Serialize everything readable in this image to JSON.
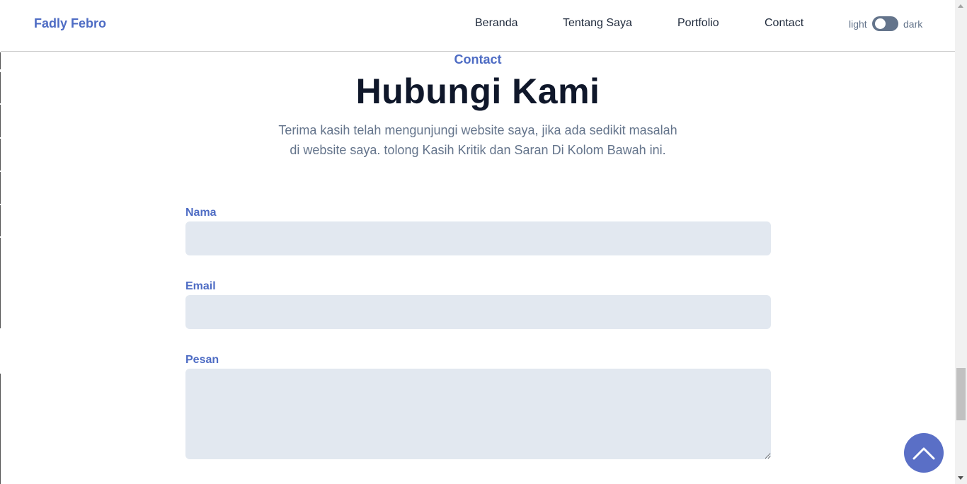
{
  "header": {
    "brand": "Fadly Febro",
    "nav": [
      "Beranda",
      "Tentang Saya",
      "Portfolio",
      "Contact"
    ],
    "theme_light": "light",
    "theme_dark": "dark"
  },
  "contact": {
    "tag": "Contact",
    "title": "Hubungi Kami",
    "description": "Terima kasih telah mengunjungi website saya, jika ada sedikit masalah di website saya. tolong Kasih Kritik dan Saran Di Kolom Bawah ini.",
    "fields": {
      "name_label": "Nama",
      "email_label": "Email",
      "message_label": "Pesan"
    }
  },
  "icons": {
    "toggle": "theme-toggle",
    "back_to_top": "chevron-up-icon"
  },
  "colors": {
    "accent": "#4e6cc4",
    "heading": "#0f172a",
    "muted": "#64748b",
    "field_bg": "#e2e8f0",
    "button_bg": "#5a6fc6"
  }
}
